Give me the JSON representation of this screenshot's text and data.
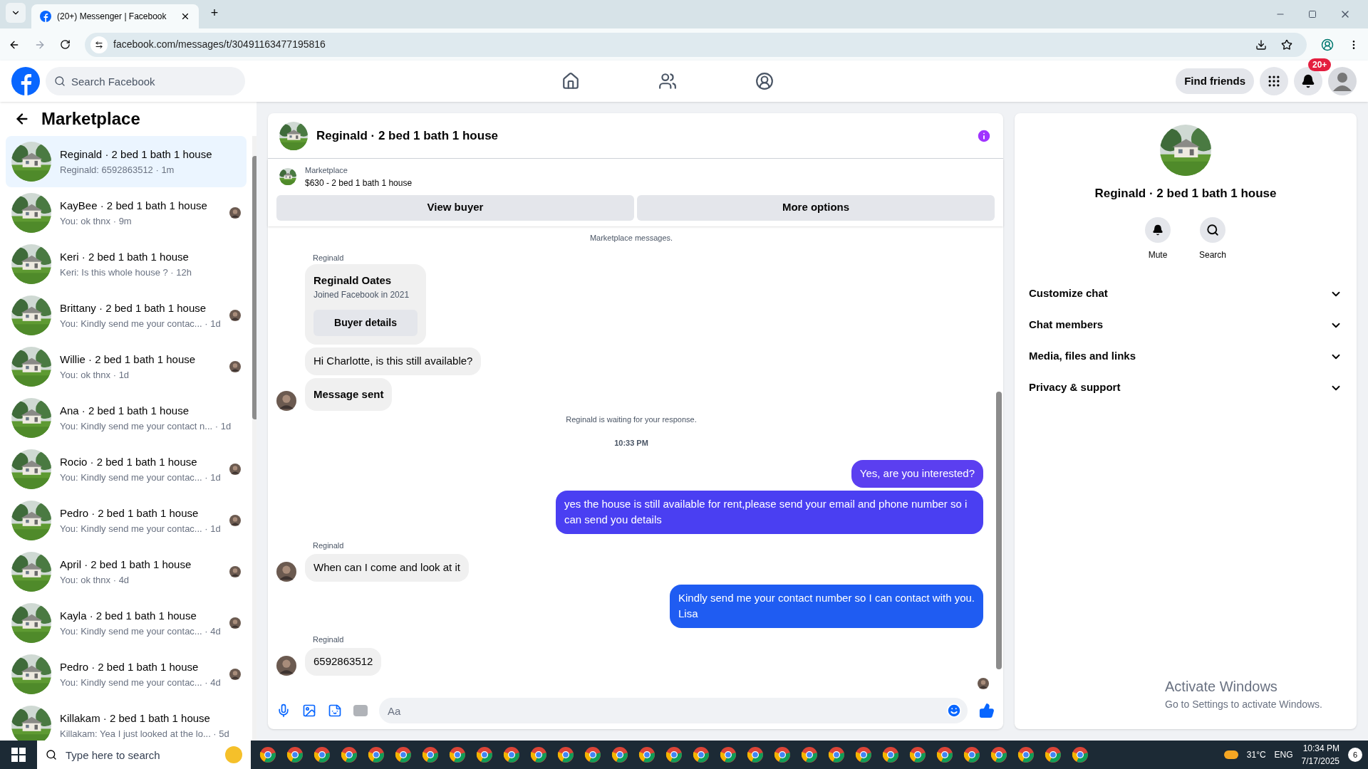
{
  "browser": {
    "tab_title": "(20+) Messenger | Facebook",
    "new_tab": "+",
    "url": "facebook.com/messages/t/30491163477195816"
  },
  "header": {
    "search_placeholder": "Search Facebook",
    "find_friends": "Find friends",
    "notification_badge": "20+"
  },
  "sidebar": {
    "title": "Marketplace",
    "items": [
      {
        "title": "Reginald · 2 bed 1 bath 1 house",
        "preview": "Reginald: 6592863512 · 1m",
        "selected": true,
        "seen_avatar": false
      },
      {
        "title": "KayBee · 2 bed 1 bath 1 house",
        "preview": "You: ok thnx · 9m",
        "selected": false,
        "seen_avatar": true
      },
      {
        "title": "Keri · 2 bed 1 bath 1 house",
        "preview": "Keri: Is this whole house ? · 12h",
        "selected": false,
        "seen_avatar": false
      },
      {
        "title": "Brittany · 2 bed 1 bath 1 house",
        "preview": "You: Kindly send me your contac... · 1d",
        "selected": false,
        "seen_avatar": true
      },
      {
        "title": "Willie · 2 bed 1 bath 1 house",
        "preview": "You: ok thnx · 1d",
        "selected": false,
        "seen_avatar": true
      },
      {
        "title": "Ana · 2 bed 1 bath 1 house",
        "preview": "You: Kindly send me your contact n... · 1d",
        "selected": false,
        "seen_avatar": false
      },
      {
        "title": "Rocio · 2 bed 1 bath 1 house",
        "preview": "You: Kindly send me your contac... · 1d",
        "selected": false,
        "seen_avatar": true
      },
      {
        "title": "Pedro · 2 bed 1 bath 1 house",
        "preview": "You: Kindly send me your contac... · 1d",
        "selected": false,
        "seen_avatar": true
      },
      {
        "title": "April · 2 bed 1 bath 1 house",
        "preview": "You: ok thnx · 4d",
        "selected": false,
        "seen_avatar": true
      },
      {
        "title": "Kayla · 2 bed 1 bath 1 house",
        "preview": "You: Kindly send me your contac... · 4d",
        "selected": false,
        "seen_avatar": true
      },
      {
        "title": "Pedro · 2 bed 1 bath 1 house",
        "preview": "You: Kindly send me your contac... · 4d",
        "selected": false,
        "seen_avatar": true
      },
      {
        "title": "Killakam · 2 bed 1 bath 1 house",
        "preview": "Killakam: Yea I just looked at the lo... · 5d",
        "selected": false,
        "seen_avatar": false
      }
    ]
  },
  "chat": {
    "title": "Reginald · 2 bed 1 bath 1 house",
    "listing": {
      "label": "Marketplace",
      "price_title": "$630 - 2 bed 1 bath 1 house"
    },
    "actions": [
      "View buyer",
      "More options"
    ],
    "messages": [
      {
        "kind": "notice",
        "text": "Marketplace messages."
      },
      {
        "kind": "sender",
        "text": "Reginald"
      },
      {
        "kind": "buyer_card",
        "name": "Reginald Oates",
        "joined": "Joined Facebook in 2021",
        "button": "Buyer details"
      },
      {
        "kind": "incoming",
        "text": "Hi Charlotte, is this still available?",
        "avatar": false,
        "bold": false
      },
      {
        "kind": "incoming",
        "text": "Message sent",
        "avatar": true,
        "bold": true
      },
      {
        "kind": "notice",
        "text": "Reginald is waiting for your response."
      },
      {
        "kind": "time",
        "text": "10:33 PM"
      },
      {
        "kind": "outgoing",
        "text": "Yes, are you interested?",
        "color": "#5b3ff0"
      },
      {
        "kind": "outgoing",
        "text": "yes the house is still available for rent,please send your email and phone number so i can send you details",
        "color": "#4a3ff2"
      },
      {
        "kind": "sender",
        "text": "Reginald"
      },
      {
        "kind": "incoming",
        "text": "When can I come and look at it",
        "avatar": true,
        "bold": false
      },
      {
        "kind": "outgoing",
        "text": "Kindly send me your contact number so I can contact with you.\nLisa",
        "color": "#1f5cf2"
      },
      {
        "kind": "sender",
        "text": "Reginald"
      },
      {
        "kind": "incoming",
        "text": "6592863512",
        "avatar": true,
        "bold": false
      }
    ],
    "composer_placeholder": "Aa"
  },
  "details": {
    "title": "Reginald · 2 bed 1 bath 1 house",
    "buttons": [
      "Mute",
      "Search"
    ],
    "sections": [
      {
        "label": "Customize chat",
        "expanded": false
      },
      {
        "label": "Chat members",
        "expanded": false
      },
      {
        "label": "Media, files and links",
        "expanded": false
      },
      {
        "label": "Privacy & support",
        "expanded": false
      }
    ]
  },
  "activation": {
    "title": "Activate Windows",
    "subtitle": "Go to Settings to activate Windows."
  },
  "taskbar": {
    "search_placeholder": "Type here to search",
    "temperature": "31°C",
    "language": "ENG",
    "time": "10:34 PM",
    "date": "7/17/2025",
    "notifications": "6"
  }
}
